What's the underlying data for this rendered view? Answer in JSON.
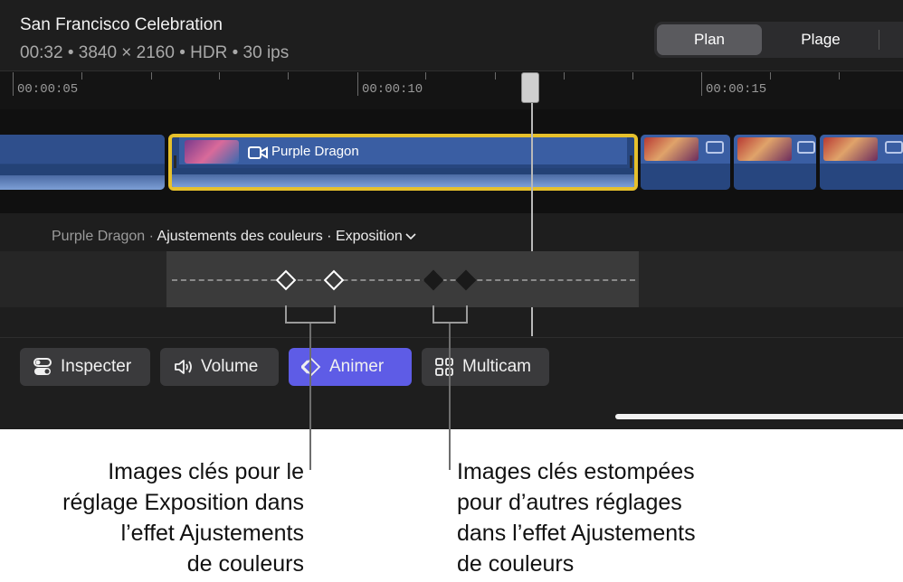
{
  "header": {
    "title": "San Francisco Celebration",
    "meta": "00:32 • 3840 × 2160 • HDR • 30 ips",
    "segments": [
      "Plan",
      "Plage"
    ]
  },
  "ruler": {
    "labels": [
      "00:00:05",
      "00:00:10",
      "00:00:15"
    ]
  },
  "clip": {
    "name": "Purple Dragon"
  },
  "breadcrumb": {
    "clip": "Purple Dragon",
    "sep": " · ",
    "effect": "Ajustements des couleurs",
    "param": "Exposition"
  },
  "toolbar": {
    "inspect": "Inspecter",
    "volume": "Volume",
    "animate": "Animer",
    "multicam": "Multicam"
  },
  "callouts": {
    "left": [
      "Images clés pour le",
      "réglage Exposition dans",
      "l’effet Ajustements",
      "de couleurs"
    ],
    "right": [
      "Images clés estompées",
      "pour d’autres réglages",
      "dans l’effet Ajustements",
      "de couleurs"
    ]
  },
  "colors": {
    "accent": "#5e5ce6",
    "selection": "#e6c02c",
    "clip": "#27467f"
  }
}
